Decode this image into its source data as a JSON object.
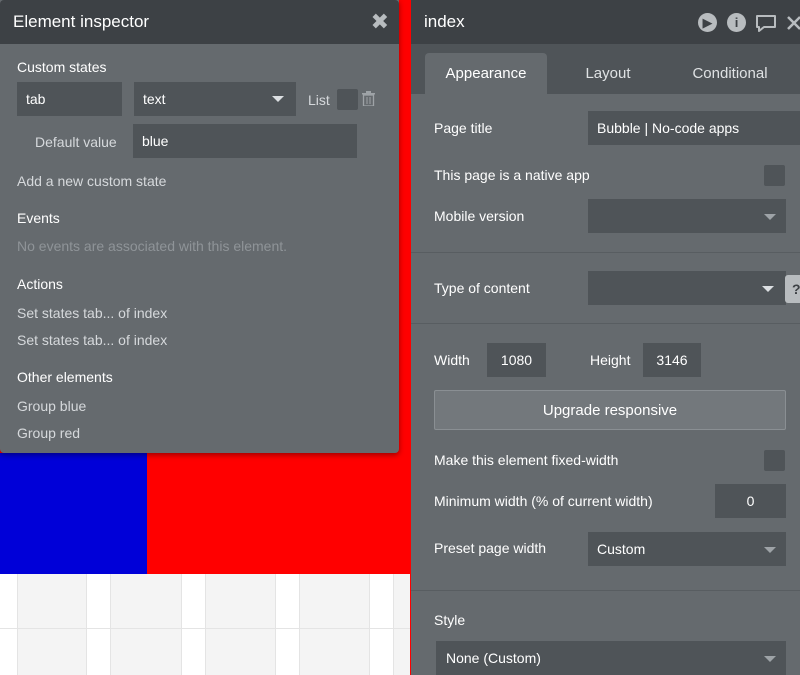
{
  "inspector": {
    "title": "Element inspector",
    "custom_states_title": "Custom states",
    "state_name": "tab",
    "state_type": "text",
    "list_label": "List",
    "default_value_label": "Default value",
    "default_value": "blue",
    "add_state_link": "Add a new custom state",
    "events_title": "Events",
    "events_empty": "No events are associated with this element.",
    "actions_title": "Actions",
    "actions": [
      "Set states tab... of index",
      "Set states tab... of index"
    ],
    "other_elements_title": "Other elements",
    "other_elements": [
      "Group blue",
      "Group red"
    ]
  },
  "property_editor": {
    "title": "index",
    "tabs": [
      "Appearance",
      "Layout",
      "Conditional"
    ],
    "active_tab": "Appearance",
    "page_title_label": "Page title",
    "page_title_value": "Bubble | No-code apps",
    "native_app_label": "This page is a native app",
    "mobile_version_label": "Mobile version",
    "mobile_version_value": "",
    "type_of_content_label": "Type of content",
    "type_of_content_value": "",
    "width_label": "Width",
    "width_value": "1080",
    "height_label": "Height",
    "height_value": "3146",
    "upgrade_button": "Upgrade responsive",
    "fixed_width_label": "Make this element fixed-width",
    "min_width_label": "Minimum width (% of current width)",
    "min_width_value": "0",
    "preset_width_label": "Preset page width",
    "preset_width_value": "Custom",
    "style_label": "Style",
    "style_value": "None (Custom)",
    "help_glyph": "?"
  },
  "icons": {
    "close": "close-icon",
    "play": "play-icon",
    "info": "info-icon",
    "comment": "comment-icon",
    "trash": "trash-icon"
  },
  "colors": {
    "canvas_red": "#ff0000",
    "canvas_blue": "#0000d8",
    "panel_bg": "#656a6e",
    "header_bg": "#3d4145",
    "field_bg": "#4f5458"
  }
}
